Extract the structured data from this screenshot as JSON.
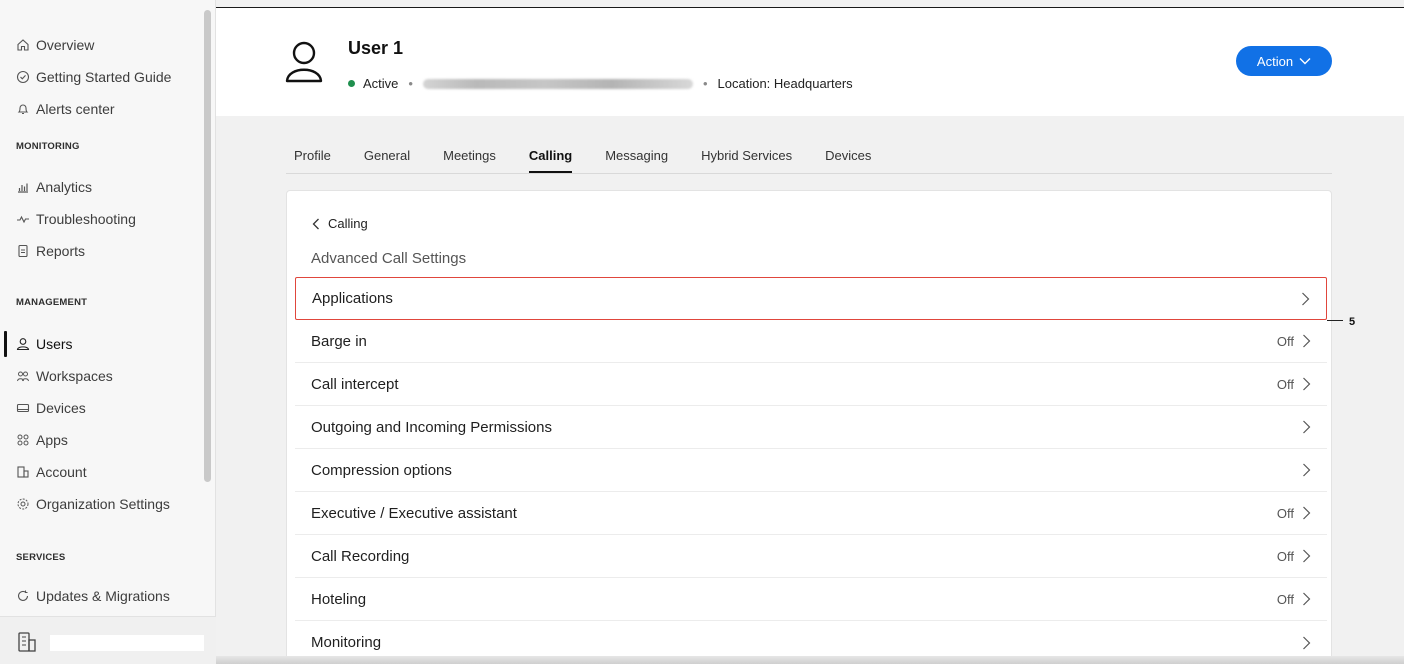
{
  "sidebar": {
    "top_items": [
      {
        "label": "Overview",
        "icon": "home-icon"
      },
      {
        "label": "Getting Started Guide",
        "icon": "check-circle-icon"
      },
      {
        "label": "Alerts center",
        "icon": "bell-icon"
      }
    ],
    "sections": [
      {
        "label": "MONITORING"
      },
      {
        "label": "MANAGEMENT"
      },
      {
        "label": "SERVICES"
      }
    ],
    "monitoring_items": [
      {
        "label": "Analytics",
        "icon": "bar-chart-icon"
      },
      {
        "label": "Troubleshooting",
        "icon": "pulse-icon"
      },
      {
        "label": "Reports",
        "icon": "document-icon"
      }
    ],
    "management_items": [
      {
        "label": "Users",
        "icon": "user-icon",
        "active": true
      },
      {
        "label": "Workspaces",
        "icon": "people-icon"
      },
      {
        "label": "Devices",
        "icon": "device-icon"
      },
      {
        "label": "Apps",
        "icon": "apps-grid-icon"
      },
      {
        "label": "Account",
        "icon": "building-icon"
      },
      {
        "label": "Organization Settings",
        "icon": "gear-icon"
      }
    ],
    "services_items": [
      {
        "label": "Updates & Migrations",
        "icon": "refresh-icon"
      }
    ]
  },
  "header": {
    "user_name": "User 1",
    "status": "Active",
    "location": "Location: Headquarters",
    "action_label": "Action",
    "accent_color": "#1171e6",
    "status_color": "#1f8f4e"
  },
  "tabs": [
    {
      "label": "Profile"
    },
    {
      "label": "General"
    },
    {
      "label": "Meetings"
    },
    {
      "label": "Calling",
      "selected": true
    },
    {
      "label": "Messaging"
    },
    {
      "label": "Hybrid Services"
    },
    {
      "label": "Devices"
    }
  ],
  "content": {
    "back_label": "Calling",
    "title": "Advanced Call Settings",
    "rows": [
      {
        "label": "Applications",
        "value": "",
        "highlighted": true
      },
      {
        "label": "Barge in",
        "value": "Off"
      },
      {
        "label": "Call intercept",
        "value": "Off"
      },
      {
        "label": "Outgoing and Incoming Permissions",
        "value": ""
      },
      {
        "label": "Compression options",
        "value": ""
      },
      {
        "label": "Executive / Executive assistant",
        "value": "Off"
      },
      {
        "label": "Call Recording",
        "value": "Off"
      },
      {
        "label": "Hoteling",
        "value": "Off"
      },
      {
        "label": "Monitoring",
        "value": ""
      }
    ],
    "callout_number": "5",
    "highlight_color": "#e0463c"
  }
}
